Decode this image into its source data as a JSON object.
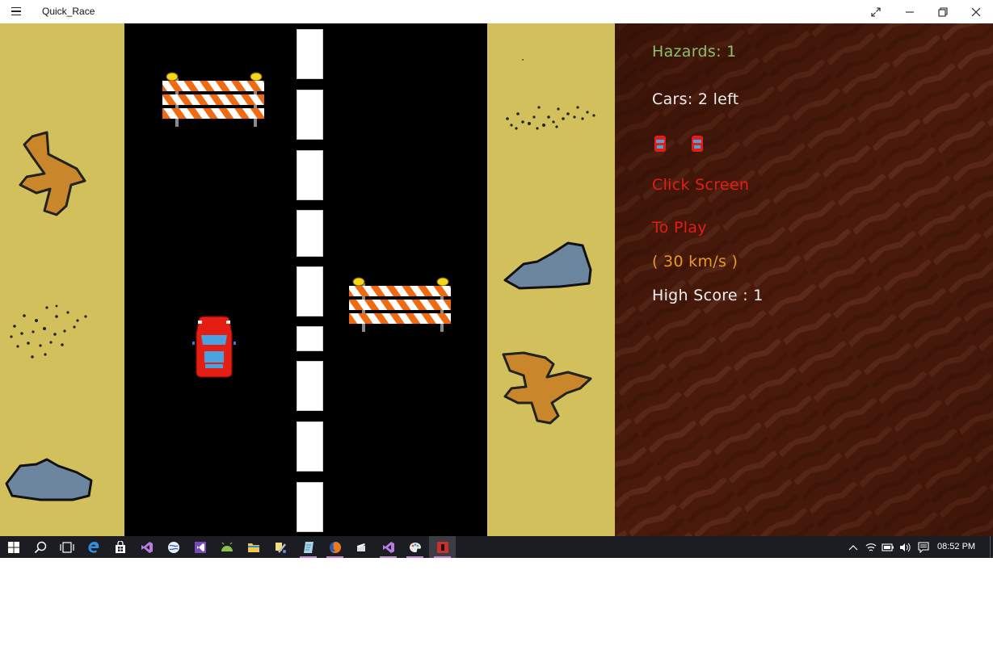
{
  "window": {
    "title": "Quick_Race"
  },
  "hud": {
    "hazards": "Hazards: 1",
    "cars": "Cars: 2 left",
    "lives_shown": 2,
    "click_line1": "Click Screen",
    "click_line2": "To Play",
    "speed": "( 30 km/s )",
    "high_score": "High Score : 1"
  },
  "colors": {
    "sand": "#d2c05c",
    "road": "#000000",
    "panel": "#4a1b0c",
    "hazards_text": "#8fbf6a",
    "prompt_text": "#e41e12",
    "speed_text": "#e89a24",
    "player_car": "#e41e12"
  },
  "taskbar": {
    "apps": [
      {
        "icon": "windows-start-icon"
      },
      {
        "icon": "search-icon"
      },
      {
        "icon": "task-view-icon"
      },
      {
        "icon": "edge-browser-icon"
      },
      {
        "icon": "store-icon"
      },
      {
        "icon": "visual-studio-icon"
      },
      {
        "icon": "globe-app-icon"
      },
      {
        "icon": "visual-studio-icon"
      },
      {
        "icon": "android-icon"
      },
      {
        "icon": "file-explorer-icon"
      },
      {
        "icon": "tools-icon"
      },
      {
        "icon": "notepad-icon"
      },
      {
        "icon": "firefox-icon"
      },
      {
        "icon": "film-icon"
      },
      {
        "icon": "visual-studio-icon"
      },
      {
        "icon": "paint-icon"
      },
      {
        "icon": "quick-race-app-icon"
      }
    ],
    "tray": [
      "chevron-up-icon",
      "wifi-icon",
      "battery-icon",
      "volume-icon",
      "notification-icon"
    ],
    "clock": "08:52 PM"
  }
}
